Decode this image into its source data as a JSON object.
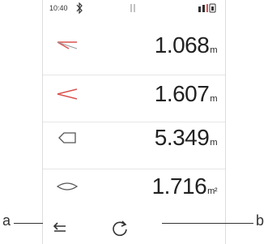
{
  "status_bar": {
    "time": "10:40",
    "bluetooth_icon": "bluetooth-icon",
    "center_icon": "antenna-icon",
    "battery_icon": "battery-icon"
  },
  "measurements": [
    {
      "icon": "distance-single-icon",
      "value": "1.068",
      "unit": "m"
    },
    {
      "icon": "distance-min-max-icon",
      "value": "1.607",
      "unit": "m"
    },
    {
      "icon": "perimeter-icon",
      "value": "5.349",
      "unit": "m"
    },
    {
      "icon": "area-icon",
      "value": "1.716",
      "unit": "m²"
    }
  ],
  "bottom_bar": {
    "back_icon": "back-arrow-icon",
    "refresh_icon": "refresh-icon"
  },
  "callouts": {
    "a": "a",
    "b": "b"
  },
  "colors": {
    "accent_red": "#d9534f",
    "text": "#222222"
  }
}
